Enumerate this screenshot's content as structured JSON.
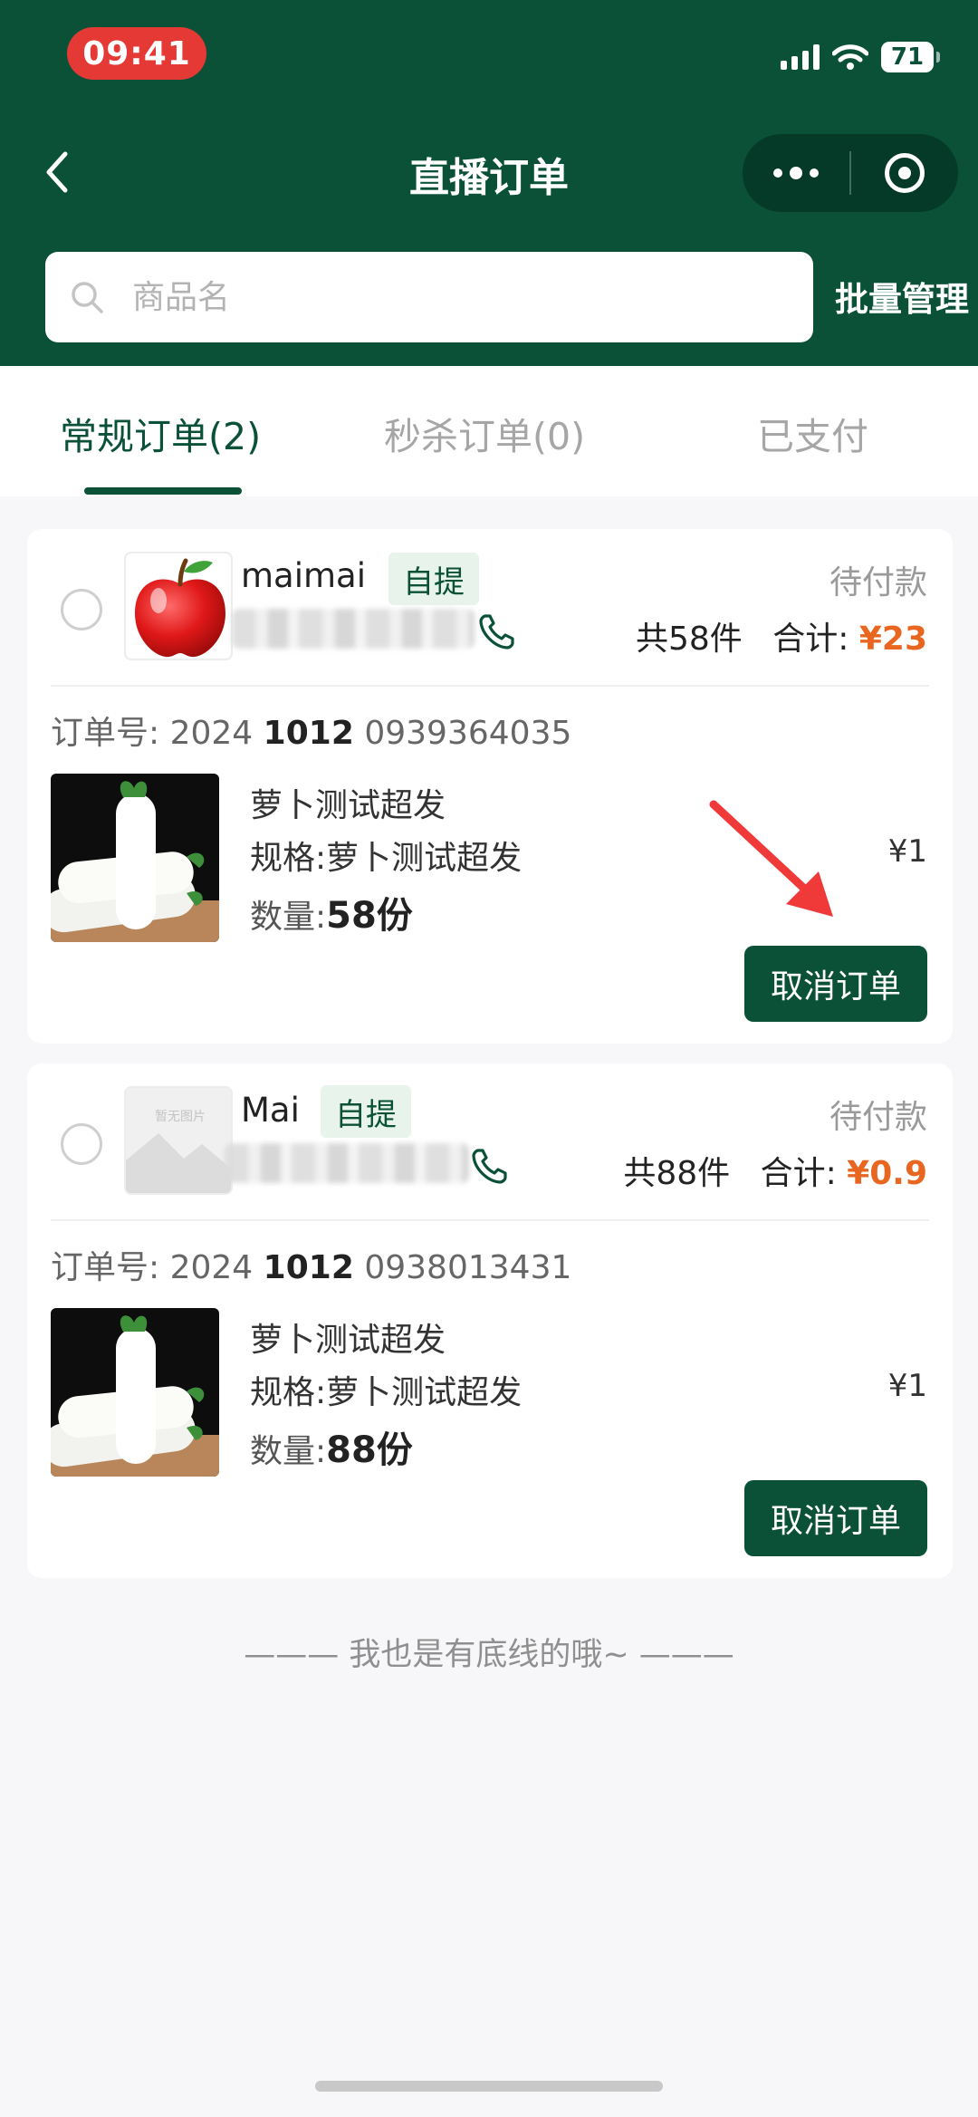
{
  "status_bar": {
    "time": "09:41",
    "battery": "71"
  },
  "nav": {
    "title": "直播订单"
  },
  "search": {
    "placeholder": "商品名",
    "batch_label": "批量管理"
  },
  "tabs": [
    {
      "label": "常规订单(2)",
      "active": true
    },
    {
      "label": "秒杀订单(0)",
      "active": false
    },
    {
      "label": "已支付",
      "active": false
    }
  ],
  "orders": [
    {
      "customer_name": "maimai",
      "delivery_tag": "自提",
      "status": "待付款",
      "count_text": "共58件",
      "total_label": "合计:",
      "total_price": "¥23",
      "order_no_label": "订单号:",
      "order_no_a": "2024",
      "order_no_b": "1012",
      "order_no_c": "0939364035",
      "product_name": "萝卜测试超发",
      "spec": "规格:萝卜测试超发",
      "qty_label": "数量:",
      "qty_value": "58份",
      "unit_price": "¥1",
      "cancel_label": "取消订单"
    },
    {
      "customer_name": "Mai",
      "delivery_tag": "自提",
      "status": "待付款",
      "count_text": "共88件",
      "total_label": "合计:",
      "total_price": "¥0.9",
      "order_no_label": "订单号:",
      "order_no_a": "2024",
      "order_no_b": "1012",
      "order_no_c": "0938013431",
      "product_name": "萝卜测试超发",
      "spec": "规格:萝卜测试超发",
      "qty_label": "数量:",
      "qty_value": "88份",
      "unit_price": "¥1",
      "cancel_label": "取消订单",
      "avatar_placeholder_text": "暂无图片"
    }
  ],
  "footer_note": "——— 我也是有底线的哦~ ———",
  "colors": {
    "brand": "#0b5138",
    "price": "#e8661f",
    "tag_bg": "#e8f3ec"
  }
}
